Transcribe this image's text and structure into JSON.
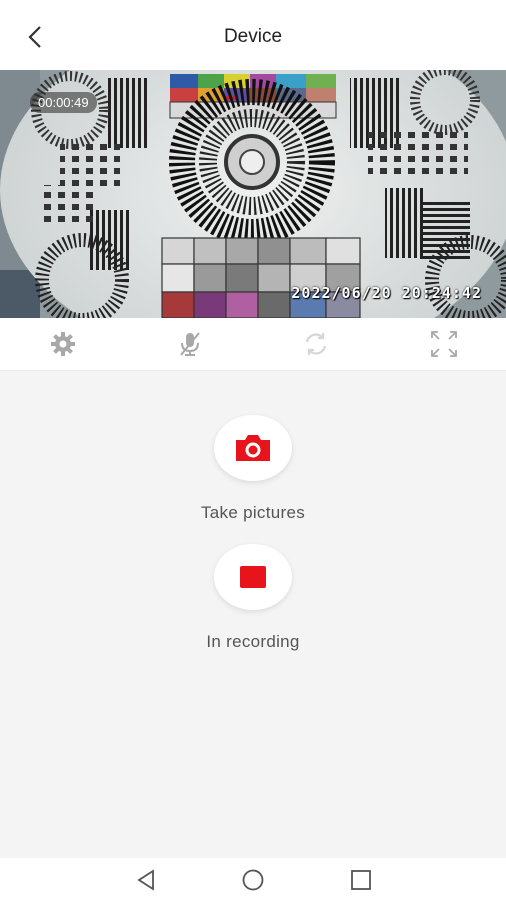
{
  "header": {
    "title": "Device",
    "back_icon": "chevron-left-icon"
  },
  "video": {
    "recording_time": "00:00:49",
    "timestamp": "2022/06/20  20:24:42"
  },
  "toolbar": {
    "icons": [
      "gear-icon",
      "mic-muted-icon",
      "rotate-icon",
      "fullscreen-icon"
    ]
  },
  "actions": {
    "take_pictures_label": "Take pictures",
    "recording_label": "In recording"
  },
  "colors": {
    "accent": "#e8141c",
    "icon_gray": "#a8a8a8"
  },
  "navbar": {
    "icons": [
      "back-triangle-icon",
      "home-circle-icon",
      "recents-square-icon"
    ]
  }
}
